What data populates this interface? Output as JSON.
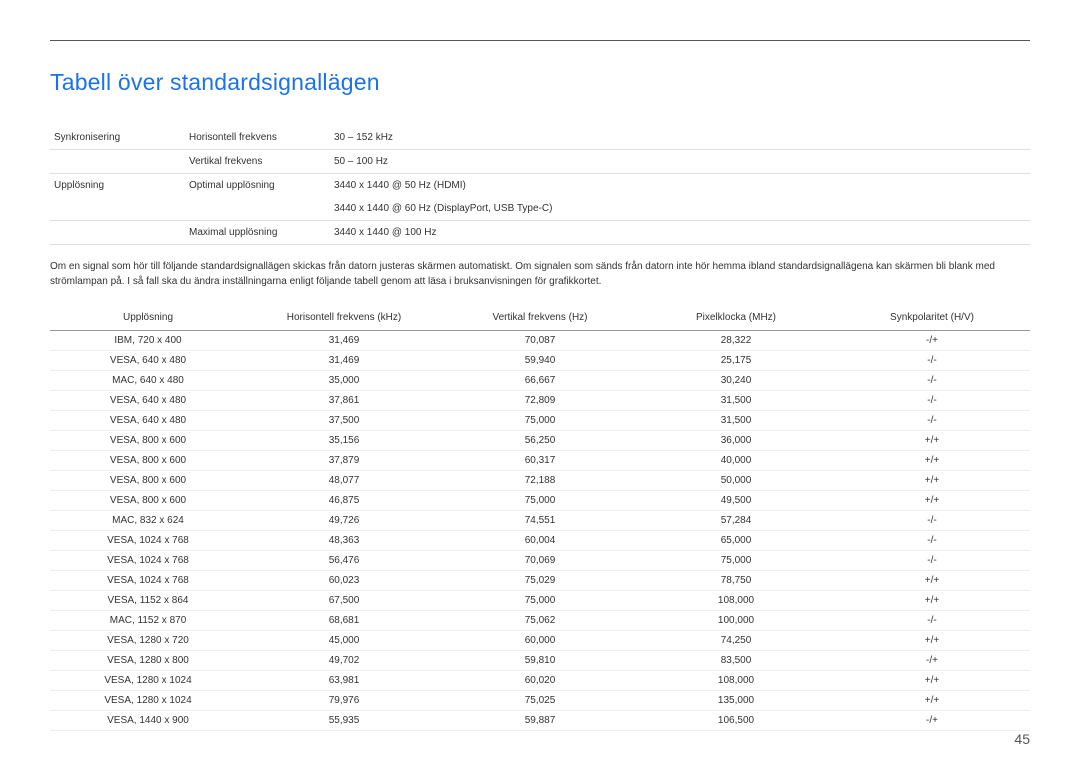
{
  "title": "Tabell över standardsignallägen",
  "spec": {
    "rows": [
      {
        "group": "Synkronisering",
        "label": "Horisontell frekvens",
        "value": "30 – 152 kHz"
      },
      {
        "group": "",
        "label": "Vertikal frekvens",
        "value": "50 – 100 Hz"
      },
      {
        "group": "Upplösning",
        "label": "Optimal upplösning",
        "value": "3440 x 1440 @ 50 Hz (HDMI)"
      },
      {
        "group": "",
        "label": "",
        "value": "3440 x 1440 @ 60 Hz (DisplayPort, USB Type-C)"
      },
      {
        "group": "",
        "label": "Maximal upplösning",
        "value": "3440 x 1440 @ 100 Hz"
      }
    ]
  },
  "description": "Om en signal som hör till följande standardsignallägen skickas från datorn justeras skärmen automatiskt. Om signalen som sänds från datorn inte hör hemma ibland standardsignallägena kan skärmen bli blank med strömlampan på. I så fall ska du ändra inställningarna enligt följande tabell genom att läsa i bruksanvisningen för grafikkortet.",
  "modes": {
    "headers": [
      "Upplösning",
      "Horisontell frekvens (kHz)",
      "Vertikal frekvens (Hz)",
      "Pixelklocka (MHz)",
      "Synkpolaritet (H/V)"
    ],
    "rows": [
      [
        "IBM, 720 x 400",
        "31,469",
        "70,087",
        "28,322",
        "-/+"
      ],
      [
        "VESA, 640 x 480",
        "31,469",
        "59,940",
        "25,175",
        "-/-"
      ],
      [
        "MAC, 640 x 480",
        "35,000",
        "66,667",
        "30,240",
        "-/-"
      ],
      [
        "VESA, 640 x 480",
        "37,861",
        "72,809",
        "31,500",
        "-/-"
      ],
      [
        "VESA, 640 x 480",
        "37,500",
        "75,000",
        "31,500",
        "-/-"
      ],
      [
        "VESA, 800 x 600",
        "35,156",
        "56,250",
        "36,000",
        "+/+"
      ],
      [
        "VESA, 800 x 600",
        "37,879",
        "60,317",
        "40,000",
        "+/+"
      ],
      [
        "VESA, 800 x 600",
        "48,077",
        "72,188",
        "50,000",
        "+/+"
      ],
      [
        "VESA, 800 x 600",
        "46,875",
        "75,000",
        "49,500",
        "+/+"
      ],
      [
        "MAC, 832 x 624",
        "49,726",
        "74,551",
        "57,284",
        "-/-"
      ],
      [
        "VESA, 1024 x 768",
        "48,363",
        "60,004",
        "65,000",
        "-/-"
      ],
      [
        "VESA, 1024 x 768",
        "56,476",
        "70,069",
        "75,000",
        "-/-"
      ],
      [
        "VESA, 1024 x 768",
        "60,023",
        "75,029",
        "78,750",
        "+/+"
      ],
      [
        "VESA, 1152 x 864",
        "67,500",
        "75,000",
        "108,000",
        "+/+"
      ],
      [
        "MAC, 1152 x 870",
        "68,681",
        "75,062",
        "100,000",
        "-/-"
      ],
      [
        "VESA, 1280 x 720",
        "45,000",
        "60,000",
        "74,250",
        "+/+"
      ],
      [
        "VESA, 1280 x 800",
        "49,702",
        "59,810",
        "83,500",
        "-/+"
      ],
      [
        "VESA, 1280 x 1024",
        "63,981",
        "60,020",
        "108,000",
        "+/+"
      ],
      [
        "VESA, 1280 x 1024",
        "79,976",
        "75,025",
        "135,000",
        "+/+"
      ],
      [
        "VESA, 1440 x 900",
        "55,935",
        "59,887",
        "106,500",
        "-/+"
      ]
    ]
  },
  "page_number": "45"
}
